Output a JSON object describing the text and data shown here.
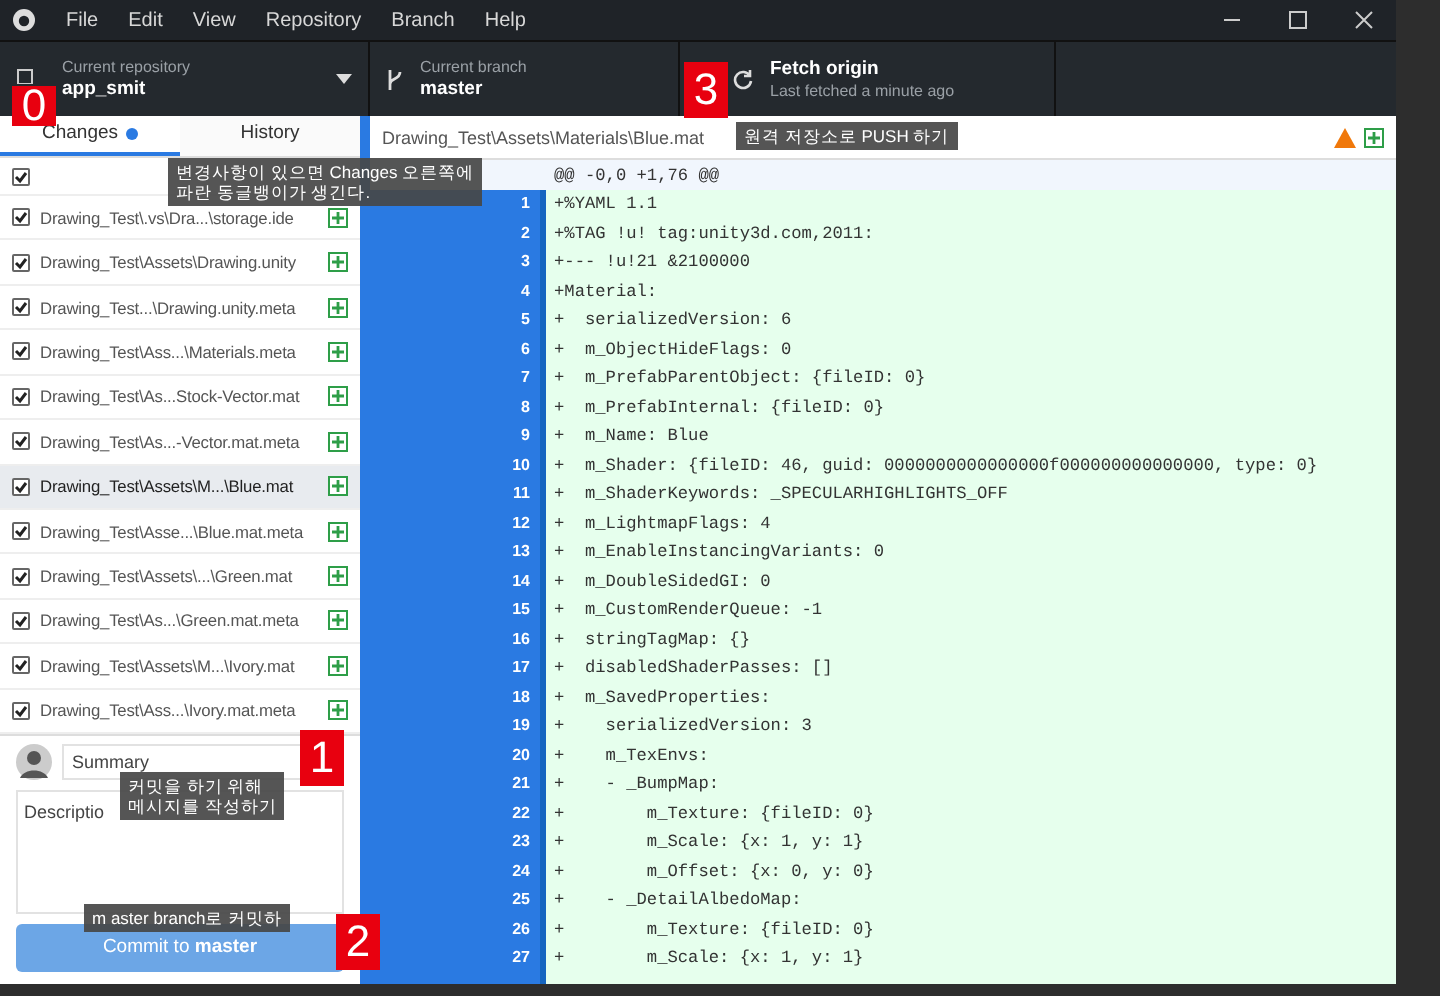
{
  "window": {
    "menu": [
      "File",
      "Edit",
      "View",
      "Repository",
      "Branch",
      "Help"
    ]
  },
  "toolbar": {
    "repository": {
      "label": "Current repository",
      "value": "app_smit"
    },
    "branch": {
      "label": "Current branch",
      "value": "master"
    },
    "fetch": {
      "title": "Fetch origin",
      "subtitle": "Last fetched a minute ago"
    }
  },
  "tabs": [
    {
      "label": "Changes",
      "selected": true,
      "has_changes": true
    },
    {
      "label": "History",
      "selected": false,
      "has_changes": false
    }
  ],
  "files": [
    {
      "checked": true,
      "selected": false
    },
    {
      "path": "Drawing_Test\\.vs\\Dra...\\storage.ide",
      "checked": true,
      "selected": false
    },
    {
      "path": "Drawing_Test\\Assets\\Drawing.unity",
      "checked": true,
      "selected": false
    },
    {
      "path": "Drawing_Test...\\Drawing.unity.meta",
      "checked": true,
      "selected": false
    },
    {
      "path": "Drawing_Test\\Ass...\\Materials.meta",
      "checked": true,
      "selected": false
    },
    {
      "path": "Drawing_Test\\As...Stock-Vector.mat",
      "checked": true,
      "selected": false
    },
    {
      "path": "Drawing_Test\\As...-Vector.mat.meta",
      "checked": true,
      "selected": false
    },
    {
      "path": "Drawing_Test\\Assets\\M...\\Blue.mat",
      "checked": true,
      "selected": true
    },
    {
      "path": "Drawing_Test\\Asse...\\Blue.mat.meta",
      "checked": true,
      "selected": false
    },
    {
      "path": "Drawing_Test\\Assets\\...\\Green.mat",
      "checked": true,
      "selected": false
    },
    {
      "path": "Drawing_Test\\As...\\Green.mat.meta",
      "checked": true,
      "selected": false
    },
    {
      "path": "Drawing_Test\\Assets\\M...\\Ivory.mat",
      "checked": true,
      "selected": false
    },
    {
      "path": "Drawing_Test\\Ass...\\Ivory.mat.meta",
      "checked": true,
      "selected": false
    }
  ],
  "commit": {
    "summary_placeholder": "Summary",
    "description_placeholder": "Descriptio",
    "button_prefix": "Commit to",
    "button_branch": "master"
  },
  "diff": {
    "file": "Drawing_Test\\Assets\\Materials\\Blue.mat",
    "hunk": "@@ -0,0 +1,76 @@",
    "lines": [
      {
        "number": "1",
        "text": "+%YAML 1.1"
      },
      {
        "number": "2",
        "text": "+%TAG !u! tag:unity3d.com,2011:"
      },
      {
        "number": "3",
        "text": "+--- !u!21 &2100000"
      },
      {
        "number": "4",
        "text": "+Material:"
      },
      {
        "number": "5",
        "text": "+  serializedVersion: 6"
      },
      {
        "number": "6",
        "text": "+  m_ObjectHideFlags: 0"
      },
      {
        "number": "7",
        "text": "+  m_PrefabParentObject: {fileID: 0}"
      },
      {
        "number": "8",
        "text": "+  m_PrefabInternal: {fileID: 0}"
      },
      {
        "number": "9",
        "text": "+  m_Name: Blue"
      },
      {
        "number": "10",
        "text": "+  m_Shader: {fileID: 46, guid: 0000000000000000f000000000000000, type: 0}"
      },
      {
        "number": "11",
        "text": "+  m_ShaderKeywords: _SPECULARHIGHLIGHTS_OFF"
      },
      {
        "number": "12",
        "text": "+  m_LightmapFlags: 4"
      },
      {
        "number": "13",
        "text": "+  m_EnableInstancingVariants: 0"
      },
      {
        "number": "14",
        "text": "+  m_DoubleSidedGI: 0"
      },
      {
        "number": "15",
        "text": "+  m_CustomRenderQueue: -1"
      },
      {
        "number": "16",
        "text": "+  stringTagMap: {}"
      },
      {
        "number": "17",
        "text": "+  disabledShaderPasses: []"
      },
      {
        "number": "18",
        "text": "+  m_SavedProperties:"
      },
      {
        "number": "19",
        "text": "+    serializedVersion: 3"
      },
      {
        "number": "20",
        "text": "+    m_TexEnvs:"
      },
      {
        "number": "21",
        "text": "+    - _BumpMap:"
      },
      {
        "number": "22",
        "text": "+        m_Texture: {fileID: 0}"
      },
      {
        "number": "23",
        "text": "+        m_Scale: {x: 1, y: 1}"
      },
      {
        "number": "24",
        "text": "+        m_Offset: {x: 0, y: 0}"
      },
      {
        "number": "25",
        "text": "+    - _DetailAlbedoMap:"
      },
      {
        "number": "26",
        "text": "+        m_Texture: {fileID: 0}"
      },
      {
        "number": "27",
        "text": "+        m_Scale: {x: 1, y: 1}"
      }
    ]
  },
  "annotations": [
    {
      "number": "0",
      "note": "변경사항이 있으면 Changes 오른쪽에\n파란 동글뱅이가 생긴다."
    },
    {
      "number": "1",
      "note": "커밋을 하기 위해\n메시지를 작성하기"
    },
    {
      "number": "2",
      "note": "m aster branch로 커밋하"
    },
    {
      "number": "3",
      "note": "원격 저장소로 PUSH 하기"
    }
  ]
}
